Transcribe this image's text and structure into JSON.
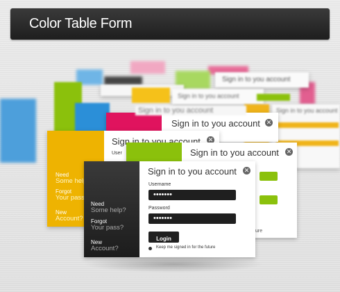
{
  "header": {
    "title": "Color Table Form"
  },
  "form": {
    "title": "Sign in to you account",
    "username_label": "Username",
    "username_value": "•••••••",
    "password_label": "Password",
    "password_value": "•••••••",
    "login_label": "Login",
    "remember_label": "Keep me signed in for the future",
    "links": [
      {
        "top": "Need",
        "bottom": "Some help?"
      },
      {
        "top": "Forgot",
        "bottom": "Your pass?"
      },
      {
        "top": "New",
        "bottom": "Account?"
      }
    ]
  },
  "stack": {
    "title": "Sign in to you account",
    "future_fragment": "ure",
    "yellow_links": [
      {
        "top": "Need",
        "bottom": "Some help"
      },
      {
        "top": "Forgot",
        "bottom": "Your pass"
      },
      {
        "top": "New",
        "bottom": "Account?"
      }
    ],
    "user_fragment": "User"
  },
  "colors": {
    "dark": "#222222",
    "yellow": "#eeb301",
    "green": "#8bc10c",
    "pink": "#e0135e",
    "blue": "#2b8fd8"
  }
}
